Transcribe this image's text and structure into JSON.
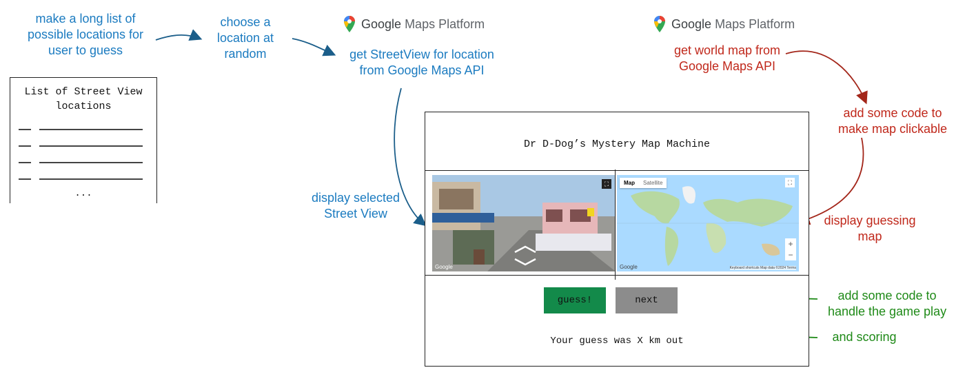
{
  "notes": {
    "make_list": [
      "make a long list of",
      "possible locations for",
      "user to guess"
    ],
    "choose": [
      "choose a",
      "location at",
      "random"
    ],
    "get_streetview": [
      "get StreetView for location",
      "from Google Maps API"
    ],
    "display_streetview": [
      "display selected",
      "Street View"
    ],
    "get_worldmap": [
      "get world map from",
      "Google Maps API"
    ],
    "clickable": [
      "add some code to",
      "make map clickable"
    ],
    "display_map": [
      "display guessing",
      "map"
    ],
    "gameplay": [
      "add some code to",
      "handle the game play"
    ],
    "scoring": "and scoring"
  },
  "list_box": {
    "title": [
      "List of Street View",
      "locations"
    ],
    "ellipsis": "..."
  },
  "logo": {
    "google": "Google",
    "maps_platform": "Maps Platform"
  },
  "app": {
    "title": "Dr D-Dog’s Mystery Map Machine",
    "guess_label": "guess!",
    "next_label": "next",
    "result": "Your guess was X km out",
    "map_tabs": [
      "Map",
      "Satellite"
    ],
    "streetview_brand": "Google",
    "map_brand": "Google",
    "map_footer": "Keyboard shortcuts   Map data ©2024   Terms"
  },
  "colors": {
    "blue": "#1b7bc0",
    "red": "#c0281b",
    "green": "#1f8a18",
    "guess_button": "#138a4a",
    "next_button": "#8c8c8c"
  }
}
